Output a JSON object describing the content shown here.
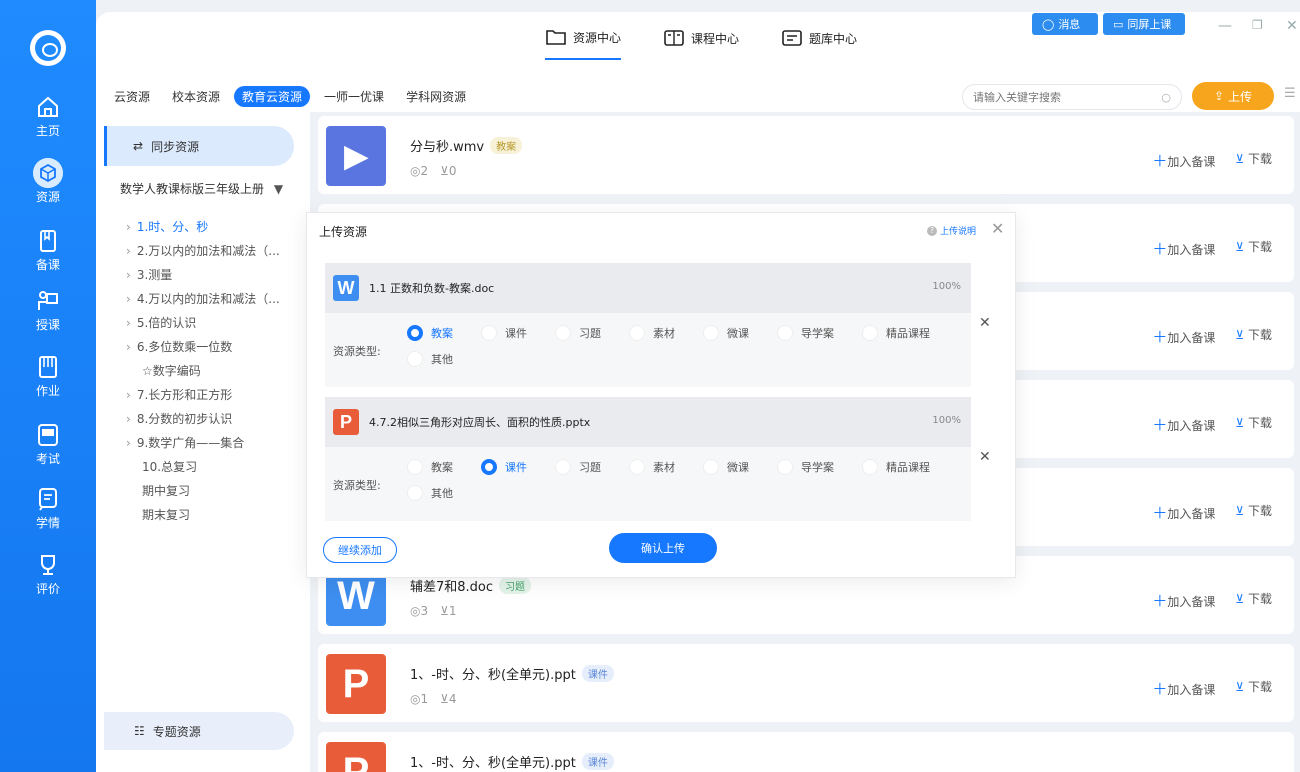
{
  "colors": {
    "primary": "#1677ff",
    "upload": "#f7a51c",
    "ppt": "#e85c3a",
    "word": "#3d8ef0",
    "video": "#5b75e0"
  },
  "rail": {
    "items": [
      {
        "label": "主页",
        "icon": "home-icon"
      },
      {
        "label": "资源",
        "icon": "resource-icon"
      },
      {
        "label": "备课",
        "icon": "lesson-prep-icon"
      },
      {
        "label": "授课",
        "icon": "teaching-icon"
      },
      {
        "label": "作业",
        "icon": "homework-icon"
      },
      {
        "label": "考试",
        "icon": "exam-icon"
      },
      {
        "label": "学情",
        "icon": "learning-status-icon"
      },
      {
        "label": "评价",
        "icon": "evaluation-icon"
      }
    ]
  },
  "topnav": {
    "tabs": [
      {
        "label": "资源中心",
        "icon": "folder-icon"
      },
      {
        "label": "课程中心",
        "icon": "book-icon"
      },
      {
        "label": "题库中心",
        "icon": "question-bank-icon"
      }
    ],
    "message_btn": "消息",
    "same_screen_btn": "同屏上课"
  },
  "subtabs": [
    "云资源",
    "校本资源",
    "教育云资源",
    "一师一优课",
    "学科网资源"
  ],
  "search": {
    "placeholder": "请输入关键字搜索"
  },
  "upload_btn": "上传",
  "tree": {
    "sync_label": "同步资源",
    "book": "数学人教课标版三年级上册",
    "nodes": [
      {
        "label": "1.时、分、秒",
        "arrow": true
      },
      {
        "label": "2.万以内的加法和减法（...",
        "arrow": true
      },
      {
        "label": "3.测量",
        "arrow": true
      },
      {
        "label": "4.万以内的加法和减法（...",
        "arrow": true
      },
      {
        "label": "5.倍的认识",
        "arrow": true
      },
      {
        "label": "6.多位数乘一位数",
        "arrow": true
      },
      {
        "label": "☆数字编码",
        "arrow": false
      },
      {
        "label": "7.长方形和正方形",
        "arrow": true
      },
      {
        "label": "8.分数的初步认识",
        "arrow": true
      },
      {
        "label": "9.数学广角——集合",
        "arrow": true
      },
      {
        "label": "10.总复习",
        "arrow": false
      },
      {
        "label": "期中复习",
        "arrow": false
      },
      {
        "label": "期末复习",
        "arrow": false
      }
    ],
    "topic_label": "专题资源"
  },
  "resources": [
    {
      "name": "分与秒.wmv",
      "tag": "教案",
      "views": "2",
      "downloads": "0",
      "type": "video"
    },
    {
      "name": "",
      "tag": "",
      "views": "",
      "downloads": "",
      "type": "hidden"
    },
    {
      "name": "",
      "tag": "",
      "views": "",
      "downloads": "",
      "type": "hidden"
    },
    {
      "name": "",
      "tag": "",
      "views": "",
      "downloads": "",
      "type": "hidden"
    },
    {
      "name": "",
      "tag": "",
      "views": "",
      "downloads": "",
      "type": "hidden"
    },
    {
      "name": "辅差7和8.doc",
      "tag": "习题",
      "views": "3",
      "downloads": "1",
      "type": "word"
    },
    {
      "name": "1、-时、分、秒(全单元).ppt",
      "tag": "课件",
      "views": "1",
      "downloads": "4",
      "type": "ppt"
    },
    {
      "name": "1、-时、分、秒(全单元).ppt",
      "tag": "课件",
      "views": "",
      "downloads": "",
      "type": "ppt"
    }
  ],
  "res_actions": {
    "add": "加入备课",
    "download": "下载"
  },
  "dialog": {
    "title": "上传资源",
    "help": "上传说明",
    "type_label": "资源类型:",
    "options": [
      "教案",
      "课件",
      "习题",
      "素材",
      "微课",
      "导学案",
      "精品课程",
      "其他"
    ],
    "files": [
      {
        "name": "1.1 正数和负数-教案.doc",
        "percent": "100%",
        "letter": "W",
        "selected": 0
      },
      {
        "name": "4.7.2相似三角形对应周长、面积的性质.pptx",
        "percent": "100%",
        "letter": "P",
        "selected": 1
      }
    ],
    "continue_btn": "继续添加",
    "confirm_btn": "确认上传"
  }
}
